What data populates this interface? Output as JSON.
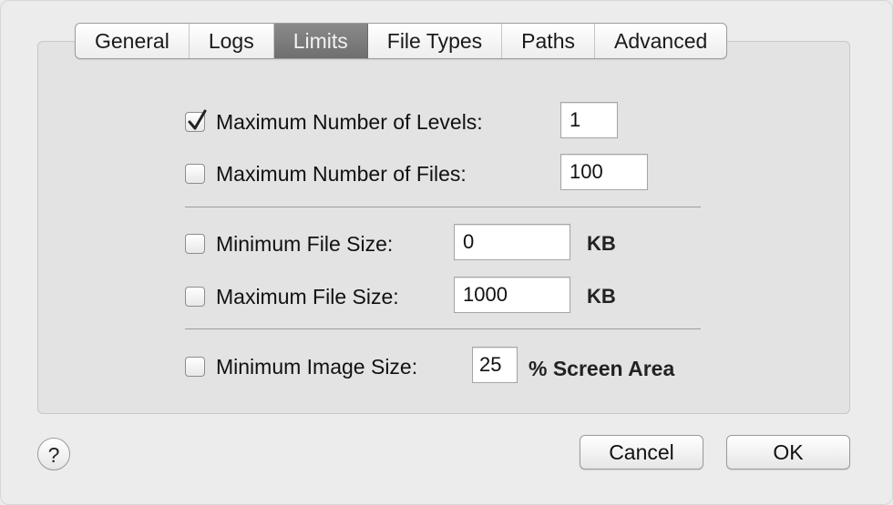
{
  "tabs": [
    {
      "label": "General",
      "active": false
    },
    {
      "label": "Logs",
      "active": false
    },
    {
      "label": "Limits",
      "active": true
    },
    {
      "label": "File Types",
      "active": false
    },
    {
      "label": "Paths",
      "active": false
    },
    {
      "label": "Advanced",
      "active": false
    }
  ],
  "limits": {
    "max_levels": {
      "label": "Maximum Number of Levels:",
      "checked": true,
      "value": "1"
    },
    "max_files": {
      "label": "Maximum Number of Files:",
      "checked": false,
      "value": "100"
    },
    "min_file_size": {
      "label": "Minimum File Size:",
      "checked": false,
      "value": "0",
      "unit": "KB"
    },
    "max_file_size": {
      "label": "Maximum File Size:",
      "checked": false,
      "value": "1000",
      "unit": "KB"
    },
    "min_image_size": {
      "label": "Minimum Image Size:",
      "checked": false,
      "value": "25",
      "unit": "% Screen Area"
    }
  },
  "buttons": {
    "help": "?",
    "cancel": "Cancel",
    "ok": "OK"
  }
}
